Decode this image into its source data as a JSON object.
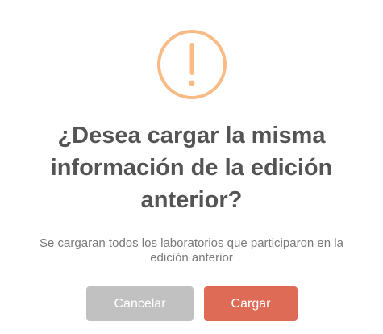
{
  "dialog": {
    "icon": "warning-icon",
    "icon_color": "#f8bb86",
    "title": "¿Desea cargar la misma información de la edición anterior?",
    "message": "Se cargaran todos los laboratorios que participaron en la edición anterior",
    "cancel_label": "Cancelar",
    "confirm_label": "Cargar",
    "cancel_color": "#c1c1c1",
    "confirm_color": "#dd6b55"
  }
}
